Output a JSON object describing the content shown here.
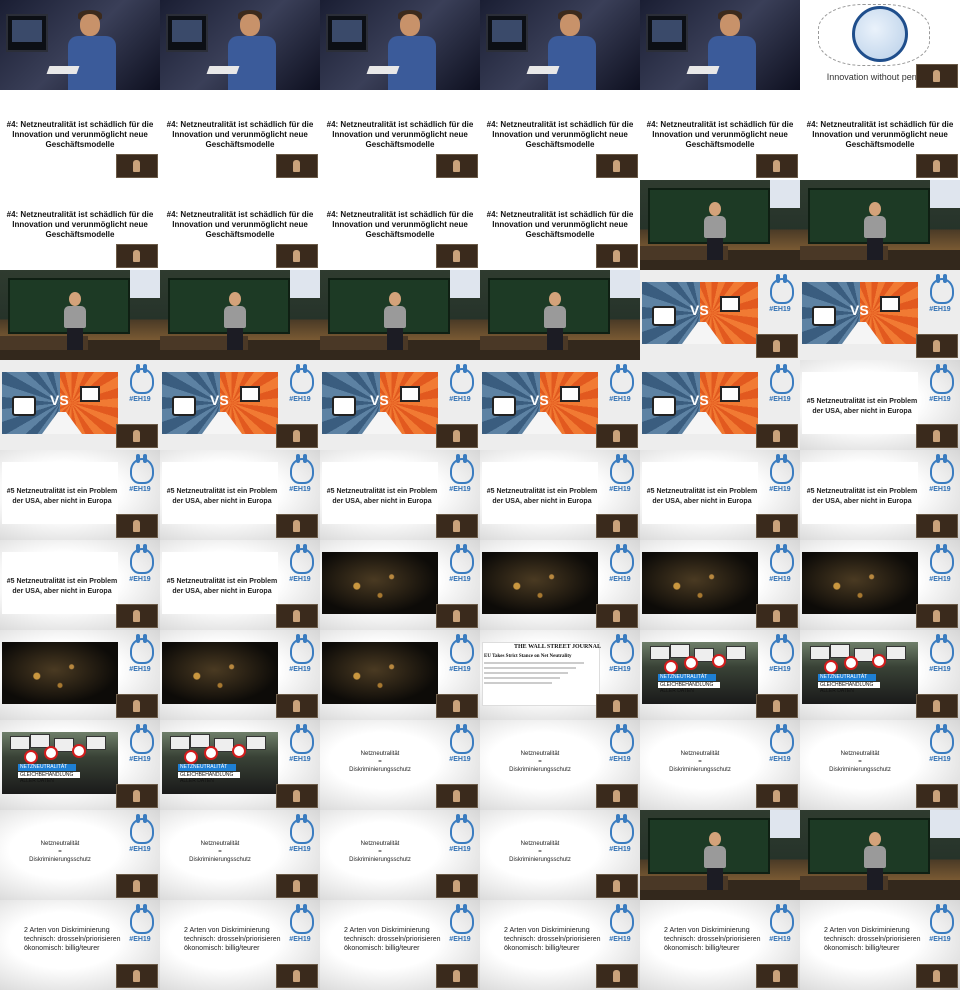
{
  "grid": {
    "columns": 6,
    "rows": 11
  },
  "texts": {
    "innovation_caption": "Innovation without permiss",
    "thesis4_line1": "#4: Netzneutralität ist schädlich für die",
    "thesis4_line2": "Innovation und verunmöglicht neue",
    "thesis4_line3": "Geschäftsmodelle",
    "vs_label": "VS",
    "thesis5_line1": "#5 Netzneutralität ist ein Problem",
    "thesis5_line2": "der USA, aber nicht in Europa",
    "wsj_masthead": "THE WALL STREET JOURNAL",
    "wsj_headline": "EU Takes Strict Stance on Net Neutrality",
    "protest_banner1": "NETZNEUTRALITÄT",
    "protest_banner2": "GLEICHBEHANDLUNG ALLER DATEN",
    "eq_line1": "Netzneutralität",
    "eq_line2": "=",
    "eq_line3": "Diskriminierungsschutz",
    "disc_line1": "2 Arten von Diskriminierung",
    "disc_line2": "technisch: drosseln/priorisieren",
    "disc_line3": "ökonomisch: billig/teurer",
    "logo_tag": "#EH19"
  },
  "tiles": [
    "laptop",
    "laptop",
    "laptop",
    "laptop",
    "laptop",
    "globe",
    "thesis4",
    "thesis4",
    "thesis4",
    "thesis4",
    "thesis4",
    "thesis4",
    "thesis4",
    "thesis4",
    "thesis4",
    "thesis4",
    "room",
    "room",
    "room",
    "room",
    "room",
    "room",
    "vs",
    "vs",
    "vs",
    "vs",
    "vs",
    "vs",
    "vs",
    "thesis5",
    "thesis5",
    "thesis5",
    "thesis5",
    "thesis5",
    "thesis5",
    "thesis5",
    "thesis5",
    "thesis5",
    "night",
    "night",
    "night",
    "night",
    "night",
    "night",
    "night",
    "wsj",
    "protest",
    "protest",
    "protest",
    "protest",
    "equals",
    "equals",
    "equals",
    "equals",
    "equals",
    "equals",
    "equals",
    "equals",
    "room",
    "room",
    "types",
    "types",
    "types",
    "types",
    "types",
    "types"
  ],
  "colors": {
    "logo_blue": "#2e6fb4",
    "vs_orange": "#e2591f",
    "vs_blue": "#3a5d7f"
  }
}
